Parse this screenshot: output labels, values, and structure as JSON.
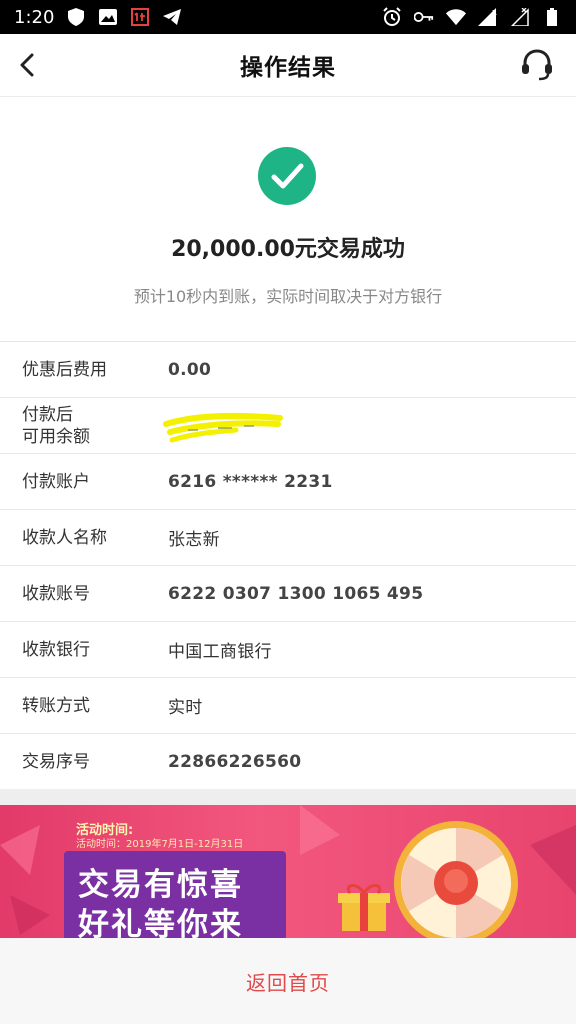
{
  "status_bar": {
    "time": "1:20"
  },
  "header": {
    "title": "操作结果"
  },
  "result": {
    "amount_text": "20,000.00元交易成功",
    "note": "预计10秒内到账，实际时间取决于对方银行"
  },
  "details": [
    {
      "label": "优惠后费用",
      "value": "0.00"
    },
    {
      "label": "付款后\n可用余额",
      "value": ""
    },
    {
      "label": "付款账户",
      "value": "6216 ****** 2231"
    },
    {
      "label": "收款人名称",
      "value": "张志新"
    },
    {
      "label": "收款账号",
      "value": "6222 0307 1300 1065 495"
    },
    {
      "label": "收款银行",
      "value": "中国工商银行"
    },
    {
      "label": "转账方式",
      "value": "实时"
    },
    {
      "label": "交易序号",
      "value": "22866226560"
    }
  ],
  "banner": {
    "activity_tag": "活动时间:",
    "activity_date": "活动时间：2019年7月1日-12月31日",
    "promo_line1": "交易有惊喜",
    "promo_line2": "好礼等你来"
  },
  "bottom": {
    "home_button": "返回首页"
  },
  "colors": {
    "success_green": "#1fb486",
    "accent_red": "#e04a4a",
    "banner_pink": "#e23a69"
  }
}
